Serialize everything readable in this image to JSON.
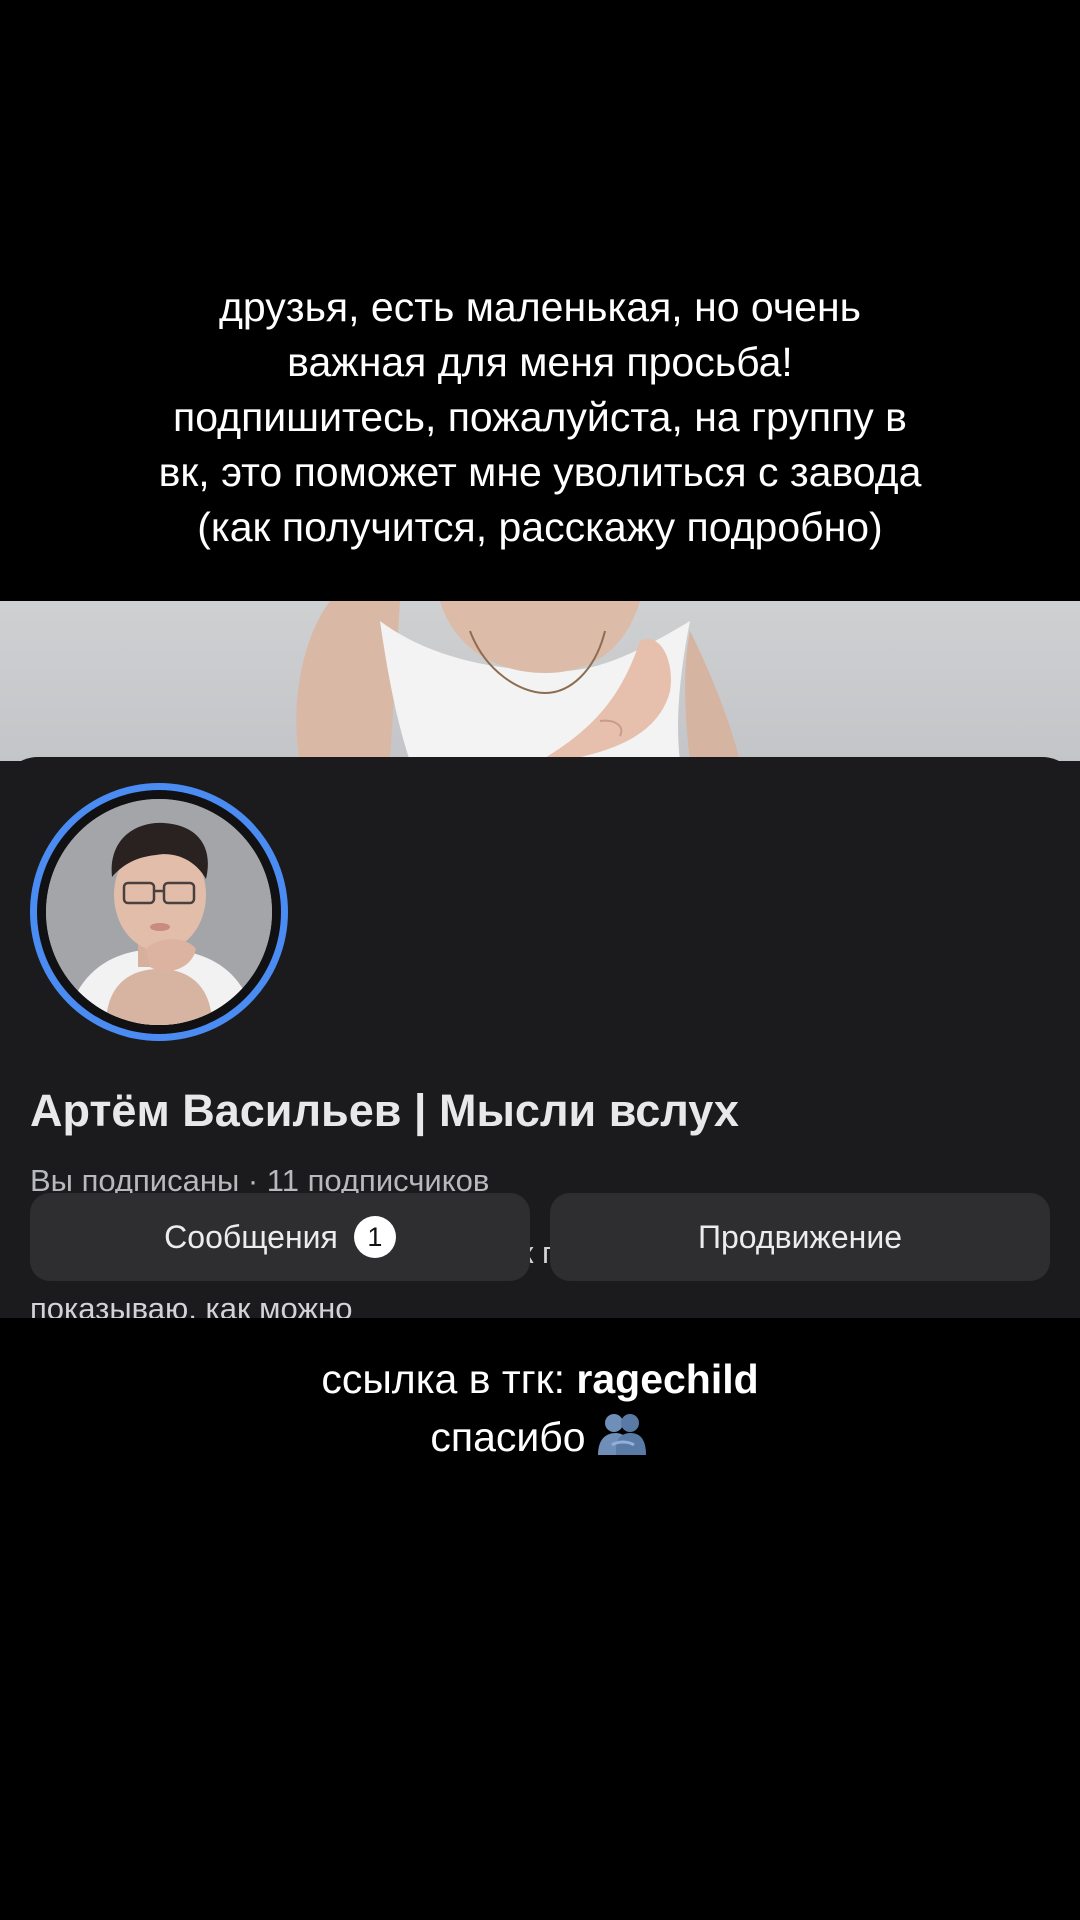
{
  "caption_top": {
    "lines": [
      "друзья, есть маленькая, но очень",
      "важная для меня просьба!",
      "подпишитесь, пожалуйста, на группу в",
      "вк, это поможет мне уволиться с завода",
      "(как получится, расскажу подробно)"
    ]
  },
  "profile": {
    "name": "Артём Васильев | Мысли вслух",
    "stats": "Вы подписаны · 11 подписчиков",
    "description_lines": [
      "Борюсь с социофобией  Не учу, как правильно, лишь",
      "показываю, как можно"
    ],
    "avatar_ring_color": "#4a8cf2"
  },
  "buttons": {
    "messages_label": "Сообщения",
    "messages_count": "1",
    "promotion_label": "Продвижение"
  },
  "caption_bottom": {
    "link_prefix": "ссылка в тгк: ",
    "link_name": "ragechild",
    "thanks": "спасибо",
    "emoji": "people-hugging-icon"
  }
}
